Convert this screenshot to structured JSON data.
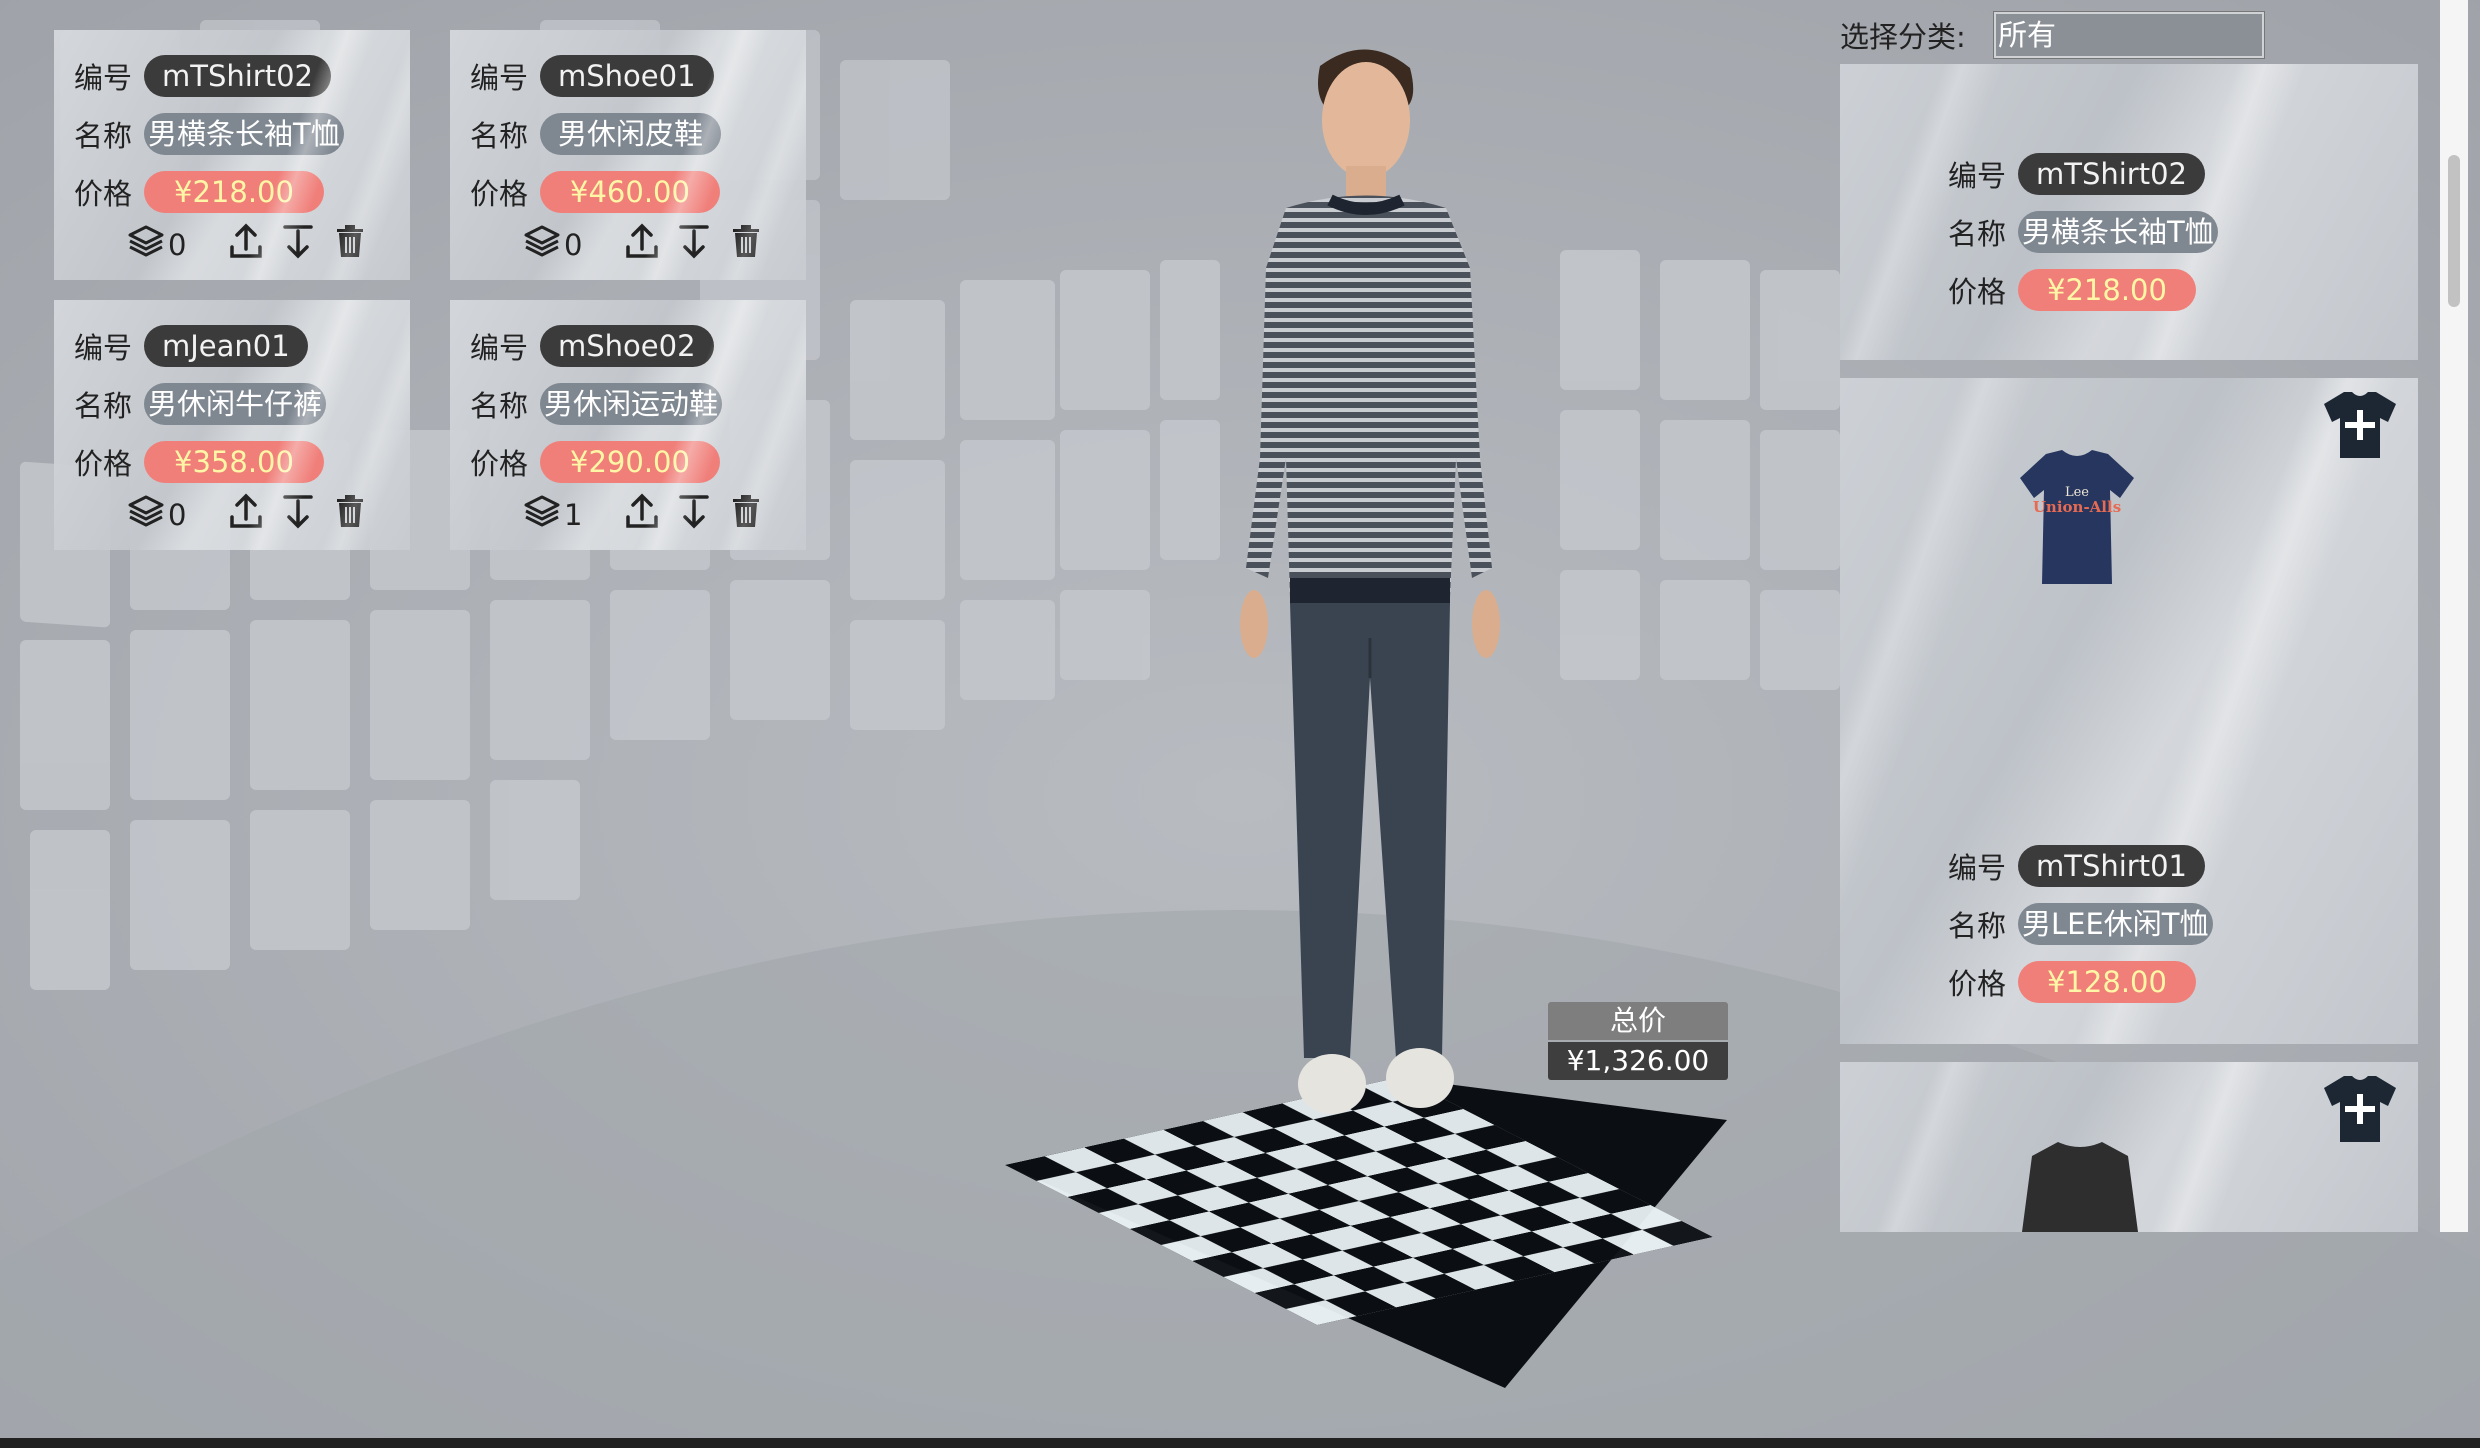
{
  "labels": {
    "code": "编号",
    "name": "名称",
    "price": "价格"
  },
  "selected_items": [
    {
      "code": "mTShirt02",
      "name": "男横条长袖T恤",
      "price": "¥218.00",
      "qty": "0"
    },
    {
      "code": "mShoe01",
      "name": "男休闲皮鞋",
      "price": "¥460.00",
      "qty": "0"
    },
    {
      "code": "mJean01",
      "name": "男休闲牛仔裤",
      "price": "¥358.00",
      "qty": "0"
    },
    {
      "code": "mShoe02",
      "name": "男休闲运动鞋",
      "price": "¥290.00",
      "qty": "1"
    }
  ],
  "total": {
    "label": "总价",
    "value": "¥1,326.00"
  },
  "filter": {
    "label": "选择分类:",
    "value": "所有"
  },
  "catalog": [
    {
      "code": "mTShirt02",
      "name": "男横条长袖T恤",
      "price": "¥218.00"
    },
    {
      "code": "mTShirt01",
      "name": "男LEE休闲T恤",
      "price": "¥128.00",
      "image_text": [
        "Lee",
        "Union-Alls"
      ]
    },
    {
      "code": "",
      "name": "",
      "price": ""
    }
  ],
  "icons": {
    "layers": "layers-icon",
    "upload": "upload-icon",
    "download": "download-icon",
    "delete": "trash-icon",
    "add_to_outfit": "add-shirt-icon"
  },
  "colors": {
    "price_pill": "#f07f7a",
    "price_text": "#fff7a6",
    "code_pill": "#3b3b3b",
    "name_pill": "#7f8791",
    "background": "#a3a7ad"
  }
}
